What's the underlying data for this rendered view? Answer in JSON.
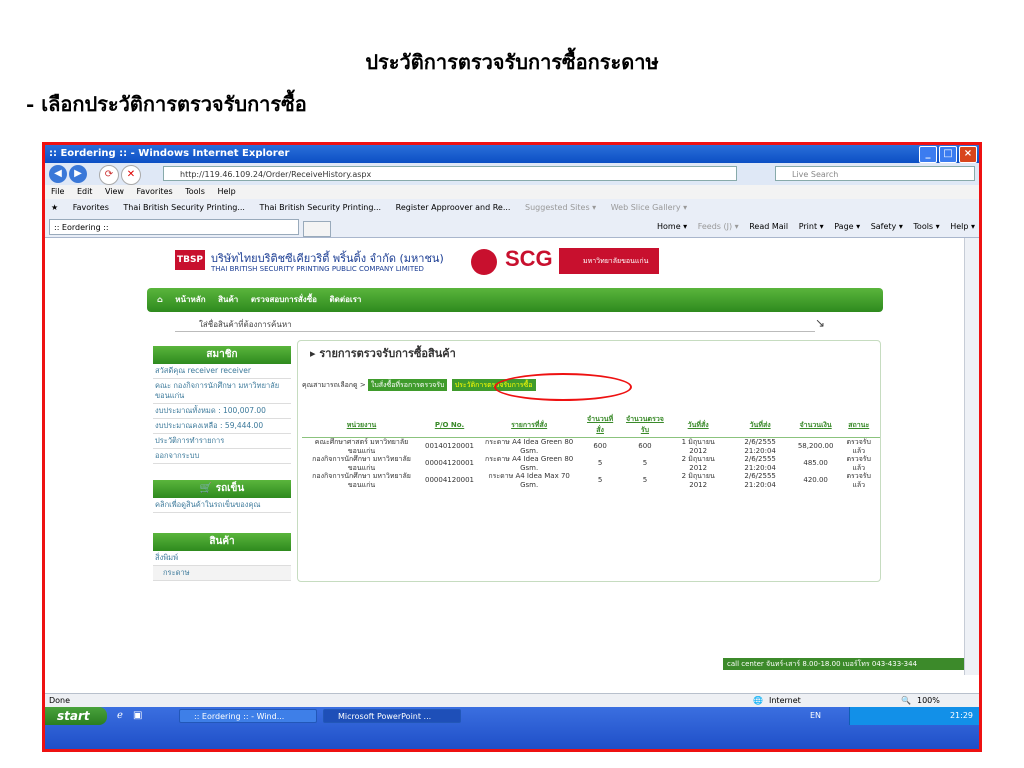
{
  "slide": {
    "title": "ประวัติการตรวจรับการซื้อกระดาษ",
    "subtitle": "- เลือกประวัติการตรวจรับการซื้อ"
  },
  "browser": {
    "window_title": ":: Eordering :: - Windows Internet Explorer",
    "url": "http://119.46.109.24/Order/ReceiveHistory.aspx",
    "search_placeholder": "Live Search",
    "menu": [
      "File",
      "Edit",
      "View",
      "Favorites",
      "Tools",
      "Help"
    ],
    "favorites_label": "Favorites",
    "favorites_links": [
      "Thai British Security Printing...",
      "Thai British Security Printing...",
      "Register Approover and Re...",
      "Suggested Sites ▾",
      "Web Slice Gallery ▾"
    ],
    "tab_label": ":: Eordering ::",
    "commands": [
      "Home ▾",
      "Feeds (J) ▾",
      "Read Mail",
      "Print ▾",
      "Page ▾",
      "Safety ▾",
      "Tools ▾",
      "Help ▾"
    ],
    "status_left": "Done",
    "status_zone": "Internet",
    "zoom": "100%"
  },
  "taskbar": {
    "start": "start",
    "items": [
      ":: Eordering :: - Wind...",
      "Microsoft PowerPoint ..."
    ],
    "lang": "EN",
    "clock": "21:29"
  },
  "page": {
    "company_th": "บริษัทไทยบริติชซีเคียวริตี้ พริ้นติ้ง จำกัด (มหาชน)",
    "company_en": "THAI BRITISH SECURITY PRINTING PUBLIC COMPANY LIMITED",
    "tbsp_logo": "TBSP",
    "scg_logo": "SCG",
    "kku_logo": "มหาวิทยาลัยขอนแก่น",
    "nav": [
      "หน้าหลัก",
      "สินค้า",
      "ตรวจสอบการสั่งซื้อ",
      "ติดต่อเรา"
    ],
    "search_placeholder": "ใส่ชื่อสินค้าที่ต้องการค้นหา",
    "sidebar": {
      "member_title": "สมาชิก",
      "member_items": [
        "สวัสดีคุณ receiver receiver",
        "คณะ กองกิจการนักศึกษา มหาวิทยาลัยขอนแก่น",
        "งบประมาณทั้งหมด : 100,007.00",
        "งบประมาณคงเหลือ : 59,444.00",
        "ประวัติการทำรายการ",
        "ออกจากระบบ"
      ],
      "cart_title": "รถเข็น",
      "cart_items": [
        "คลิกเพื่อดูสินค้าในรถเข็นของคุณ"
      ],
      "product_title": "สินค้า",
      "product_items": [
        "สิ่งพิมพ์",
        "กระดาษ"
      ]
    },
    "main_title": "รายการตรวจรับการซื้อสินค้า",
    "breadcrumb_prefix": "คุณสามารถเลือกดู >",
    "breadcrumb_link": "ใบสั่งซื้อที่รอการตรวจรับ",
    "breadcrumb_active": "ประวัติการตรวจรับการซื้อ",
    "table": {
      "headers": [
        "หน่วยงาน",
        "P/O No.",
        "รายการที่สั่ง",
        "จำนวนที่สั่ง",
        "จำนวนตรวจรับ",
        "วันที่สั่ง",
        "วันที่ส่ง",
        "จำนวนเงิน",
        "สถานะ"
      ],
      "rows": [
        [
          "คณะศึกษาศาสตร์ มหาวิทยาลัยขอนแก่น",
          "00140120001",
          "กระดาษ A4 Idea Green 80 Gsm.",
          "600",
          "600",
          "1 มิถุนายน 2012",
          "2/6/2555 21:20:04",
          "58,200.00",
          "ตรวจรับแล้ว"
        ],
        [
          "กองกิจการนักศึกษา มหาวิทยาลัยขอนแก่น",
          "00004120001",
          "กระดาษ A4 Idea Green 80 Gsm.",
          "5",
          "5",
          "2 มิถุนายน 2012",
          "2/6/2555 21:20:04",
          "485.00",
          "ตรวจรับแล้ว"
        ],
        [
          "กองกิจการนักศึกษา มหาวิทยาลัยขอนแก่น",
          "00004120001",
          "กระดาษ A4 Idea Max 70 Gsm.",
          "5",
          "5",
          "2 มิถุนายน 2012",
          "2/6/2555 21:20:04",
          "420.00",
          "ตรวจรับแล้ว"
        ]
      ]
    },
    "call_center": "call center จันทร์-เสาร์ 8.00-18.00 เบอร์โทร 043-433-344"
  }
}
